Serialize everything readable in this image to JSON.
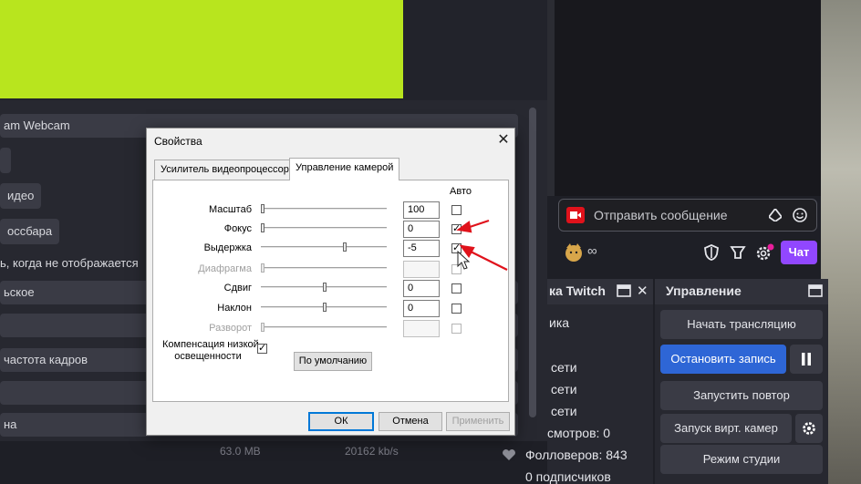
{
  "obs": {
    "source_select": "am Webcam",
    "button_video": "идео",
    "button_crossbar": "оссбара",
    "checkbox_label": "ь, когда не отображается",
    "select_mode": "ьское",
    "framerate_label": "частота кадров",
    "stat_size": "63.0 MB",
    "stat_rate": "20162 kb/s"
  },
  "chat": {
    "placeholder": "Отправить сообщение",
    "points": "∞",
    "chat_button": "Чат"
  },
  "twitch_panel": {
    "title": "ка Twitch",
    "subtitle": "ика",
    "line1": "сети",
    "line2": "сети",
    "line3": "сети",
    "views": "смотров: 0",
    "followers": "Фолловеров: 843",
    "subscribers": "0 подписчиков",
    "cut_label": "на"
  },
  "controls": {
    "title": "Управление",
    "start_stream": "Начать трансляцию",
    "stop_recording": "Остановить запись",
    "start_replay": "Запустить повтор",
    "virtual_cam": "Запуск вирт. камер",
    "studio_mode": "Режим студии"
  },
  "dialog": {
    "title": "Свойства",
    "tabs": [
      "Усилитель видеопроцессора",
      "Управление камерой"
    ],
    "auto_header": "Авто",
    "rows": [
      {
        "label": "Масштаб",
        "value": "100",
        "enabled": true,
        "auto": false
      },
      {
        "label": "Фокус",
        "value": "0",
        "enabled": true,
        "auto": true
      },
      {
        "label": "Выдержка",
        "value": "-5",
        "enabled": true,
        "auto": true
      },
      {
        "label": "Диафрагма",
        "value": "",
        "enabled": false,
        "auto": false
      },
      {
        "label": "Сдвиг",
        "value": "0",
        "enabled": true,
        "auto": false
      },
      {
        "label": "Наклон",
        "value": "0",
        "enabled": true,
        "auto": false
      },
      {
        "label": "Разворот",
        "value": "",
        "enabled": false,
        "auto": false
      }
    ],
    "low_light_label_1": "Компенсация низкой",
    "low_light_label_2": "освещенности",
    "low_light_checked": true,
    "default_button": "По умолчанию",
    "ok_button": "ОК",
    "cancel_button": "Отмена",
    "apply_button": "Применить"
  },
  "colors": {
    "accent_purple": "#9147ff",
    "primary_blue": "#2e66d6",
    "source_green": "#b8e51e",
    "annotation_red": "#e0121b"
  }
}
